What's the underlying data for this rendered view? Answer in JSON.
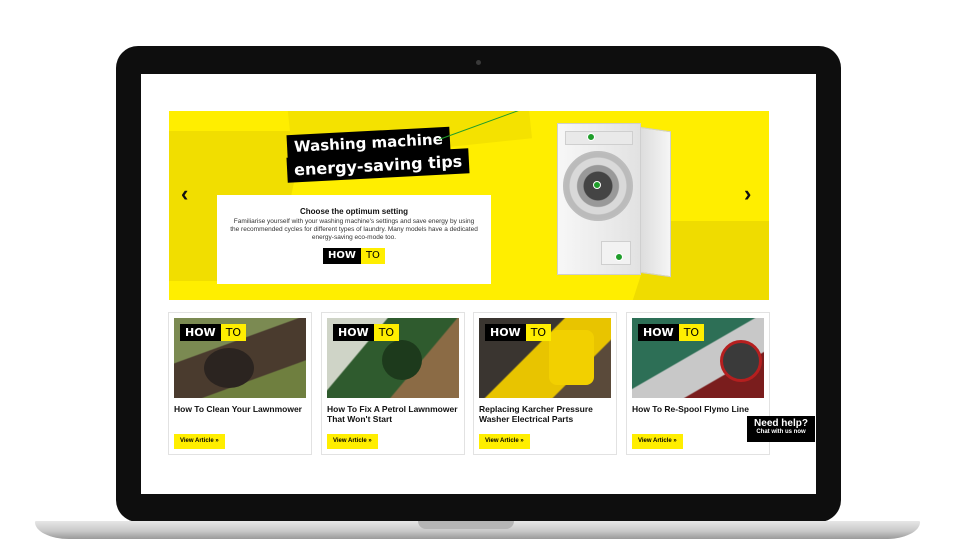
{
  "hero": {
    "title_line1": "Washing machine",
    "title_line2": "energy-saving tips",
    "prev_arrow": "‹",
    "next_arrow": "›",
    "info_title": "Choose the optimum setting",
    "info_text": "Familiarise yourself with your washing machine's settings and save energy by using the recommended cycles for different types of laundry. Many models have a dedicated energy-saving eco-mode too.",
    "howto_how": "HOW",
    "howto_to": "TO"
  },
  "cards": [
    {
      "title": "How To Clean Your Lawnmower",
      "button": "View Article »",
      "how": "HOW",
      "to": "TO"
    },
    {
      "title": "How To Fix A Petrol Lawnmower That Won't Start",
      "button": "View Article »",
      "how": "HOW",
      "to": "TO"
    },
    {
      "title": "Replacing Karcher Pressure Washer Electrical Parts",
      "button": "View Article »",
      "how": "HOW",
      "to": "TO"
    },
    {
      "title": "How To Re-Spool Flymo Line",
      "button": "View Article »",
      "how": "HOW",
      "to": "TO"
    }
  ],
  "chat": {
    "title": "Need help?",
    "subtitle": "Chat with us now"
  },
  "colors": {
    "brand_yellow": "#ffee00",
    "black": "#000000",
    "accent_green": "#1f9d2b"
  }
}
